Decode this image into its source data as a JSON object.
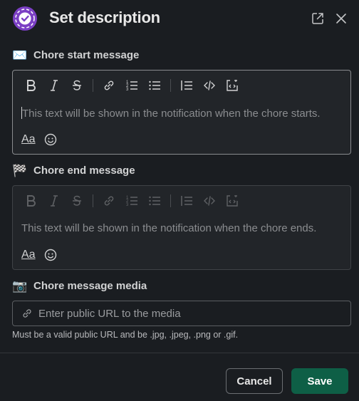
{
  "header": {
    "title": "Set description",
    "open_icon": "external-link-icon",
    "close_icon": "close-icon",
    "logo_icon": "app-logo-icon"
  },
  "start_message": {
    "emoji": "✉️",
    "label": "Chore start message",
    "placeholder": "This text will be shown in the notification when the chore starts.",
    "format_label": "Aa"
  },
  "end_message": {
    "emoji": "🏁",
    "label": "Chore end message",
    "placeholder": "This text will be shown in the notification when the chore ends.",
    "format_label": "Aa"
  },
  "media": {
    "emoji": "📷",
    "label": "Chore message media",
    "placeholder": "Enter public URL to the media",
    "hint": "Must be a valid public URL and be .jpg, .jpeg, .png or .gif."
  },
  "toolbar": [
    "bold-icon",
    "italic-icon",
    "strikethrough-icon",
    "link-icon",
    "ordered-list-icon",
    "bulleted-list-icon",
    "blockquote-icon",
    "code-icon",
    "code-block-icon"
  ],
  "footer": {
    "cancel_label": "Cancel",
    "save_label": "Save"
  },
  "colors": {
    "background": "#1a1d21",
    "save_button": "#0e5f46",
    "logo": "#7b3fc4"
  }
}
